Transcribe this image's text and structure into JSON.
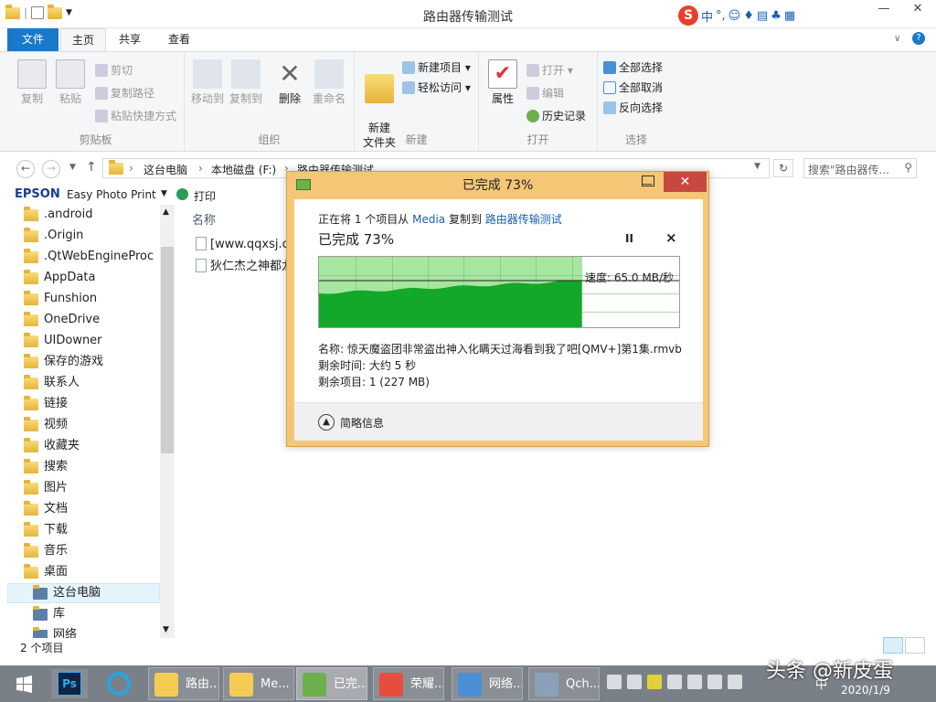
{
  "window": {
    "title": "路由器传输测试"
  },
  "ime": {
    "logo": "S",
    "mode": "中",
    "punct": "°,"
  },
  "ribbon": {
    "tabs": [
      "文件",
      "主页",
      "共享",
      "查看"
    ],
    "clipboard": {
      "copy": "复制",
      "paste": "粘贴",
      "cut": "剪切",
      "copy_path": "复制路径",
      "paste_shortcut": "粘贴快捷方式",
      "title": "剪贴板"
    },
    "organize": {
      "move_to": "移动到",
      "copy_to": "复制到",
      "delete": "删除",
      "rename": "重命名",
      "title": "组织"
    },
    "new": {
      "new_folder": "新建\n文件夹",
      "new_item": "新建项目",
      "easy_access": "轻松访问",
      "title": "新建"
    },
    "open": {
      "properties": "属性",
      "open": "打开",
      "edit": "编辑",
      "history": "历史记录",
      "title": "打开"
    },
    "select": {
      "select_all": "全部选择",
      "select_none": "全部取消",
      "invert": "反向选择",
      "title": "选择"
    }
  },
  "address": {
    "crumbs": [
      "这台电脑",
      "本地磁盘 (F:)",
      "路由器传输测试"
    ],
    "search_placeholder": "搜索\"路由器传..."
  },
  "toolbar2": {
    "epson": "EPSON",
    "epson_app": "Easy Photo Print",
    "print": "打印"
  },
  "nav": {
    "items": [
      ".android",
      ".Origin",
      ".QtWebEngineProc",
      "AppData",
      "Funshion",
      "OneDrive",
      "UIDowner",
      "保存的游戏",
      "联系人",
      "链接",
      "视频",
      "收藏夹",
      "搜索",
      "图片",
      "文档",
      "下载",
      "音乐",
      "桌面",
      "这台电脑",
      "库",
      "网络"
    ]
  },
  "content": {
    "column_name": "名称",
    "files": [
      "[www.qqxsj.co",
      "狄仁杰之神都龙"
    ]
  },
  "status": {
    "item_count": "2 个项目"
  },
  "dialog": {
    "title": "已完成 73%",
    "copy_prefix": "正在将 1 个项目从 ",
    "source": "Media",
    "copy_mid": " 复制到 ",
    "dest": "路由器传输测试",
    "progress_label": "已完成 73%",
    "progress": 0.73,
    "speed": "速度: 65.0 MB/秒",
    "name_line": "名称: 惊天魔盗团非常盗出神入化瞒天过海看到我了吧[QMV+]第1集.rmvb",
    "time_left": "剩余时间: 大约 5 秒",
    "items_left": "剩余项目: 1 (227 MB)",
    "less_details": "简略信息",
    "pause": "II",
    "close": "×"
  },
  "taskbar": {
    "buttons": [
      "路由...",
      "Me...",
      "已完...",
      "荣耀...",
      "网络...",
      "Qch..."
    ],
    "date": "2020/1/9"
  },
  "watermark": "头条 @新皮蛋"
}
